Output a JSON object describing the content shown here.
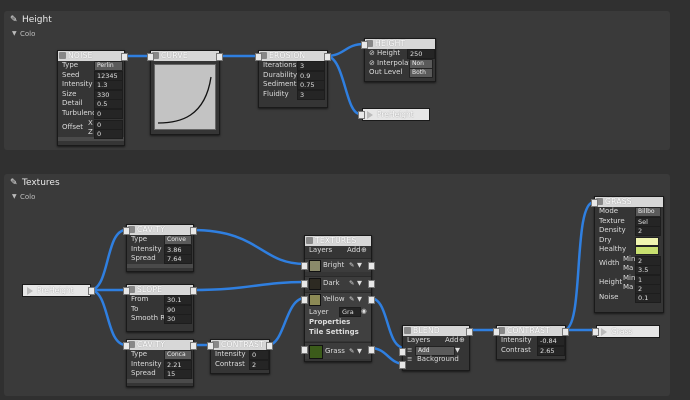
{
  "height_group": {
    "title": "Height",
    "sub": "Colo"
  },
  "textures_group": {
    "title": "Textures",
    "sub": "Colo"
  },
  "noise": {
    "title": "NOISE",
    "rows": [
      {
        "label": "Type",
        "value": "Perlin"
      },
      {
        "label": "Seed",
        "value": "12345"
      },
      {
        "label": "Intensity",
        "value": "1.3"
      },
      {
        "label": "Size",
        "value": "330"
      },
      {
        "label": "Detail",
        "value": "0.5"
      },
      {
        "label": "Turbulence",
        "value": "0"
      }
    ],
    "offset_label": "Offset",
    "offset_x_label": "X",
    "offset_x": "0",
    "offset_z_label": "Z",
    "offset_z": "0"
  },
  "curve": {
    "title": "CURVE"
  },
  "erosion": {
    "title": "EROSION",
    "rows": [
      {
        "label": "Iterations",
        "value": "3"
      },
      {
        "label": "Durability",
        "value": "0.9"
      },
      {
        "label": "Sediment",
        "value": "0.75"
      },
      {
        "label": "Fluidity",
        "value": "3"
      }
    ]
  },
  "height_node": {
    "title": "HEIGHT",
    "height_label": "Height",
    "height_value": "250",
    "interp_label": "Interpolat",
    "interp_value": "Non",
    "outlevel_label": "Out Level",
    "outlevel_value": "Both"
  },
  "preheight_out": {
    "label": "PreHeight"
  },
  "preheight_in": {
    "label": "PreHeight"
  },
  "cavity1": {
    "title": "CAVITY",
    "rows": [
      {
        "label": "Type",
        "value": "Conve"
      },
      {
        "label": "Intensity",
        "value": "3.86"
      },
      {
        "label": "Spread",
        "value": "7.64"
      }
    ]
  },
  "slope": {
    "title": "SLOPE",
    "rows": [
      {
        "label": "From",
        "value": "30.1"
      },
      {
        "label": "To",
        "value": "90"
      },
      {
        "label": "Smooth Ra",
        "value": "30"
      }
    ]
  },
  "cavity2": {
    "title": "CAVITY",
    "rows": [
      {
        "label": "Type",
        "value": "Conca"
      },
      {
        "label": "Intensity",
        "value": "2.21"
      },
      {
        "label": "Spread",
        "value": "15"
      }
    ]
  },
  "contrast1": {
    "title": "CONTRAST",
    "rows": [
      {
        "label": "Intensity",
        "value": "0"
      },
      {
        "label": "Contrast",
        "value": "2"
      }
    ]
  },
  "textures": {
    "title": "TEXTURES",
    "layers_label": "Layers",
    "add_label": "Add",
    "layer_names": [
      "Bright",
      "Dark",
      "Yellow",
      "Grass"
    ],
    "layer_field_label": "Layer",
    "layer_field_value": "Gra",
    "properties": "Properties",
    "tile_settings": "Tile Settings"
  },
  "blend": {
    "title": "BLEND",
    "layers_label": "Layers",
    "add_label": "Add",
    "mode_value": "Add",
    "background_label": "Background"
  },
  "contrast2": {
    "title": "CONTRAST",
    "rows": [
      {
        "label": "Intensity",
        "value": "-0.84"
      },
      {
        "label": "Contrast",
        "value": "2.65"
      }
    ]
  },
  "grass_node": {
    "title": "GRASS",
    "mode_label": "Mode",
    "mode_value": "Billbo",
    "texture_label": "Texture",
    "texture_value": "Sel",
    "density_label": "Density",
    "density_value": "2",
    "dry_label": "Dry",
    "healthy_label": "Healthy",
    "width_label": "Width",
    "width_min_label": "Min",
    "width_min": "2",
    "width_max_label": "Ma",
    "width_max": "3.5",
    "height_label": "Height",
    "height_min_label": "Min",
    "height_min": "1",
    "height_max_label": "Ma",
    "height_max": "2",
    "noise_label": "Noise",
    "noise_value": "0.1"
  },
  "grass_out": {
    "label": "Grass"
  },
  "colors": {
    "wire": "#2f7fe0",
    "header": "#d7d7d7",
    "bg": "#303030",
    "group": "#3a3a3a",
    "dry": "#f0f5b0",
    "healthy": "#c8e070",
    "grass_swatch": "#3b5b1a",
    "yellow_swatch": "#8c8a55"
  }
}
